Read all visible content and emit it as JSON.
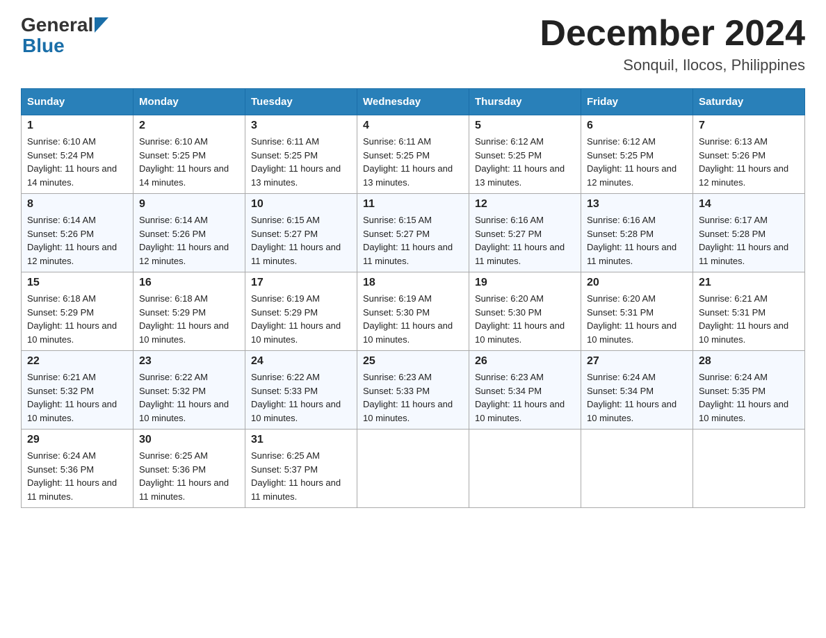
{
  "logo": {
    "general": "General",
    "blue": "Blue"
  },
  "title": "December 2024",
  "subtitle": "Sonquil, Ilocos, Philippines",
  "days": [
    "Sunday",
    "Monday",
    "Tuesday",
    "Wednesday",
    "Thursday",
    "Friday",
    "Saturday"
  ],
  "weeks": [
    [
      {
        "num": "1",
        "sunrise": "6:10 AM",
        "sunset": "5:24 PM",
        "daylight": "11 hours and 14 minutes."
      },
      {
        "num": "2",
        "sunrise": "6:10 AM",
        "sunset": "5:25 PM",
        "daylight": "11 hours and 14 minutes."
      },
      {
        "num": "3",
        "sunrise": "6:11 AM",
        "sunset": "5:25 PM",
        "daylight": "11 hours and 13 minutes."
      },
      {
        "num": "4",
        "sunrise": "6:11 AM",
        "sunset": "5:25 PM",
        "daylight": "11 hours and 13 minutes."
      },
      {
        "num": "5",
        "sunrise": "6:12 AM",
        "sunset": "5:25 PM",
        "daylight": "11 hours and 13 minutes."
      },
      {
        "num": "6",
        "sunrise": "6:12 AM",
        "sunset": "5:25 PM",
        "daylight": "11 hours and 12 minutes."
      },
      {
        "num": "7",
        "sunrise": "6:13 AM",
        "sunset": "5:26 PM",
        "daylight": "11 hours and 12 minutes."
      }
    ],
    [
      {
        "num": "8",
        "sunrise": "6:14 AM",
        "sunset": "5:26 PM",
        "daylight": "11 hours and 12 minutes."
      },
      {
        "num": "9",
        "sunrise": "6:14 AM",
        "sunset": "5:26 PM",
        "daylight": "11 hours and 12 minutes."
      },
      {
        "num": "10",
        "sunrise": "6:15 AM",
        "sunset": "5:27 PM",
        "daylight": "11 hours and 11 minutes."
      },
      {
        "num": "11",
        "sunrise": "6:15 AM",
        "sunset": "5:27 PM",
        "daylight": "11 hours and 11 minutes."
      },
      {
        "num": "12",
        "sunrise": "6:16 AM",
        "sunset": "5:27 PM",
        "daylight": "11 hours and 11 minutes."
      },
      {
        "num": "13",
        "sunrise": "6:16 AM",
        "sunset": "5:28 PM",
        "daylight": "11 hours and 11 minutes."
      },
      {
        "num": "14",
        "sunrise": "6:17 AM",
        "sunset": "5:28 PM",
        "daylight": "11 hours and 11 minutes."
      }
    ],
    [
      {
        "num": "15",
        "sunrise": "6:18 AM",
        "sunset": "5:29 PM",
        "daylight": "11 hours and 10 minutes."
      },
      {
        "num": "16",
        "sunrise": "6:18 AM",
        "sunset": "5:29 PM",
        "daylight": "11 hours and 10 minutes."
      },
      {
        "num": "17",
        "sunrise": "6:19 AM",
        "sunset": "5:29 PM",
        "daylight": "11 hours and 10 minutes."
      },
      {
        "num": "18",
        "sunrise": "6:19 AM",
        "sunset": "5:30 PM",
        "daylight": "11 hours and 10 minutes."
      },
      {
        "num": "19",
        "sunrise": "6:20 AM",
        "sunset": "5:30 PM",
        "daylight": "11 hours and 10 minutes."
      },
      {
        "num": "20",
        "sunrise": "6:20 AM",
        "sunset": "5:31 PM",
        "daylight": "11 hours and 10 minutes."
      },
      {
        "num": "21",
        "sunrise": "6:21 AM",
        "sunset": "5:31 PM",
        "daylight": "11 hours and 10 minutes."
      }
    ],
    [
      {
        "num": "22",
        "sunrise": "6:21 AM",
        "sunset": "5:32 PM",
        "daylight": "11 hours and 10 minutes."
      },
      {
        "num": "23",
        "sunrise": "6:22 AM",
        "sunset": "5:32 PM",
        "daylight": "11 hours and 10 minutes."
      },
      {
        "num": "24",
        "sunrise": "6:22 AM",
        "sunset": "5:33 PM",
        "daylight": "11 hours and 10 minutes."
      },
      {
        "num": "25",
        "sunrise": "6:23 AM",
        "sunset": "5:33 PM",
        "daylight": "11 hours and 10 minutes."
      },
      {
        "num": "26",
        "sunrise": "6:23 AM",
        "sunset": "5:34 PM",
        "daylight": "11 hours and 10 minutes."
      },
      {
        "num": "27",
        "sunrise": "6:24 AM",
        "sunset": "5:34 PM",
        "daylight": "11 hours and 10 minutes."
      },
      {
        "num": "28",
        "sunrise": "6:24 AM",
        "sunset": "5:35 PM",
        "daylight": "11 hours and 10 minutes."
      }
    ],
    [
      {
        "num": "29",
        "sunrise": "6:24 AM",
        "sunset": "5:36 PM",
        "daylight": "11 hours and 11 minutes."
      },
      {
        "num": "30",
        "sunrise": "6:25 AM",
        "sunset": "5:36 PM",
        "daylight": "11 hours and 11 minutes."
      },
      {
        "num": "31",
        "sunrise": "6:25 AM",
        "sunset": "5:37 PM",
        "daylight": "11 hours and 11 minutes."
      },
      null,
      null,
      null,
      null
    ]
  ]
}
